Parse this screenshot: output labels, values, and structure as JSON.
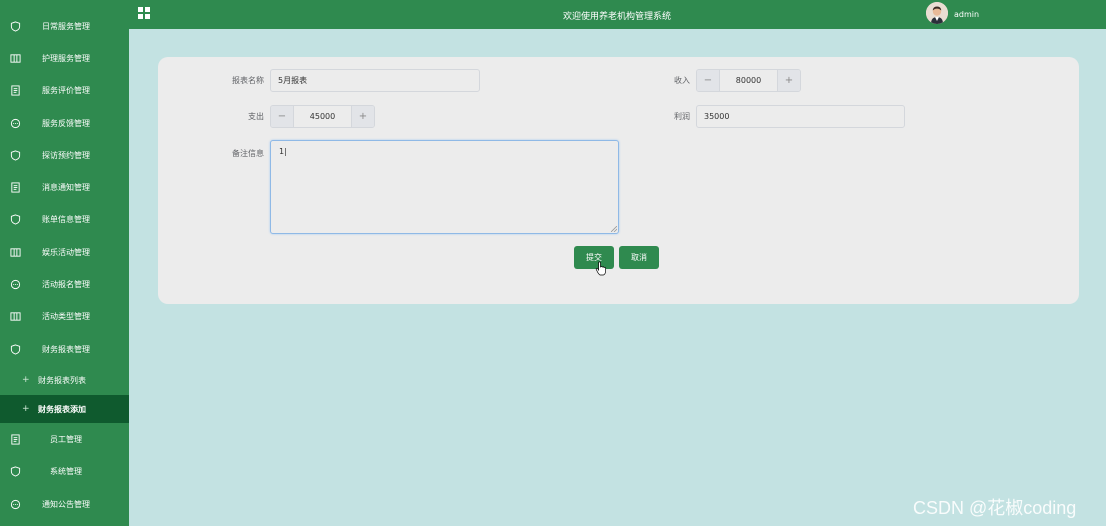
{
  "header": {
    "site_title": "欢迎使用养老机构管理系统",
    "user_name": "admin"
  },
  "sidebar": {
    "items": [
      {
        "label": "日常服务管理",
        "icon": "shield-icon"
      },
      {
        "label": "护理服务管理",
        "icon": "columns-icon"
      },
      {
        "label": "服务评价管理",
        "icon": "document-icon"
      },
      {
        "label": "服务反馈管理",
        "icon": "chat-icon"
      },
      {
        "label": "探访预约管理",
        "icon": "shield-icon"
      },
      {
        "label": "消息通知管理",
        "icon": "document-icon"
      },
      {
        "label": "账单信息管理",
        "icon": "shield-icon"
      },
      {
        "label": "娱乐活动管理",
        "icon": "columns-icon"
      },
      {
        "label": "活动报名管理",
        "icon": "chat-icon"
      },
      {
        "label": "活动类型管理",
        "icon": "columns-icon"
      },
      {
        "label": "财务报表管理",
        "icon": "shield-icon"
      },
      {
        "label": "员工管理",
        "icon": "document-icon"
      },
      {
        "label": "系统管理",
        "icon": "shield-icon"
      },
      {
        "label": "通知公告管理",
        "icon": "chat-icon"
      }
    ],
    "subitems": [
      {
        "label": "财务报表列表",
        "active": false
      },
      {
        "label": "财务报表添加",
        "active": true
      }
    ]
  },
  "form": {
    "report_name_label": "报表名称",
    "report_name_value": "5月报表",
    "income_label": "收入",
    "income_value": "80000",
    "expense_label": "支出",
    "expense_value": "45000",
    "profit_label": "利润",
    "profit_value": "35000",
    "remark_label": "备注信息",
    "remark_value": "1|",
    "stepper_minus": "−",
    "stepper_plus": "+",
    "submit_label": "提交",
    "cancel_label": "取消"
  },
  "watermark": "CSDN @花椒coding",
  "colors": {
    "primary": "#2f8a4f",
    "active_sub": "#0f5a2e",
    "background": "#c3e2e2",
    "card": "#ececec"
  }
}
